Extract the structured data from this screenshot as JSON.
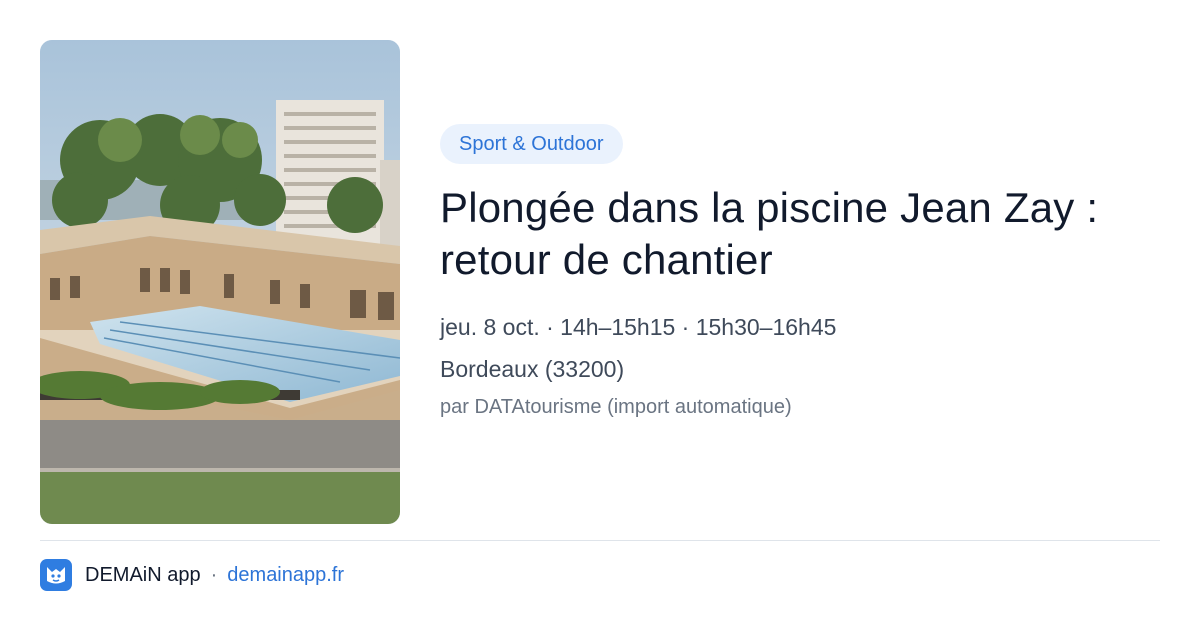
{
  "event": {
    "category": "Sport & Outdoor",
    "title": "Plongée dans la piscine Jean Zay : retour de chantier",
    "schedule": "jeu. 8 oct. · 14h–15h15 · 15h30–16h45",
    "location": "Bordeaux (33200)",
    "source": "par DATAtourisme (import automatique)",
    "image_icon": "pool-photo"
  },
  "footer": {
    "app_name": "DEMAiN app",
    "separator": "·",
    "link": "demainapp.fr",
    "app_icon": "demain-logo-icon"
  },
  "colors": {
    "accent": "#2d74d7",
    "badge_bg": "#eaf2fd",
    "title": "#111a2c",
    "meta": "#3f4a5a",
    "source": "#6a7482",
    "divider": "#dfe4ea"
  }
}
